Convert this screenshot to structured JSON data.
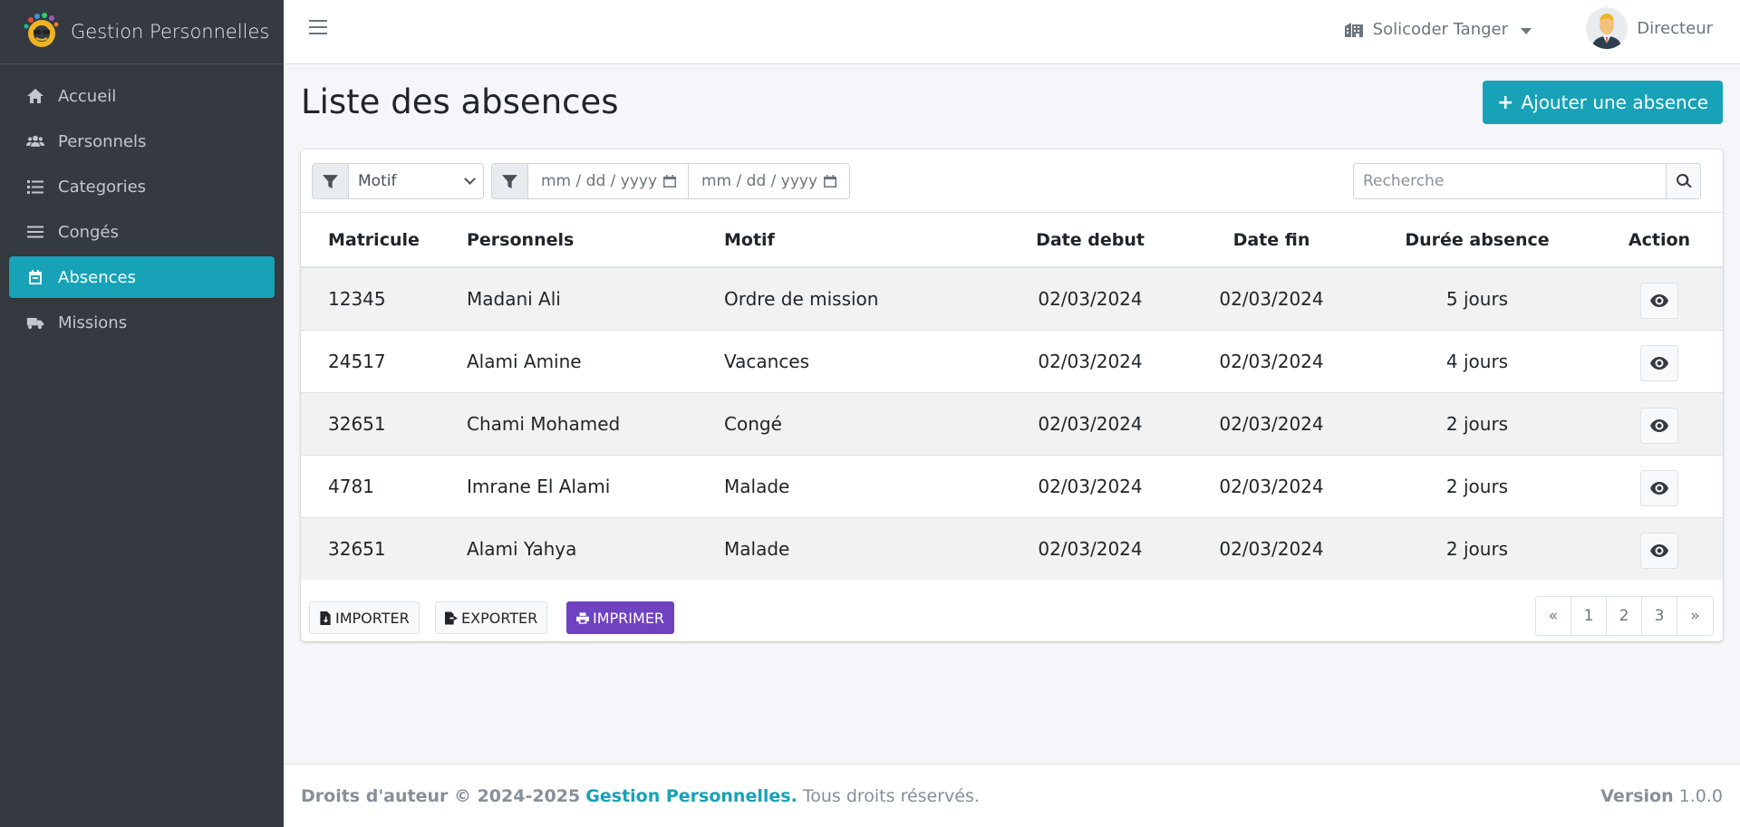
{
  "brand": {
    "name": "Gestion Personnelles"
  },
  "sidebar": {
    "items": [
      {
        "label": "Accueil",
        "icon": "home-icon"
      },
      {
        "label": "Personnels",
        "icon": "users-icon"
      },
      {
        "label": "Categories",
        "icon": "list-icon"
      },
      {
        "label": "Congés",
        "icon": "bars-icon"
      },
      {
        "label": "Absences",
        "icon": "calendar-icon",
        "active": true
      },
      {
        "label": "Missions",
        "icon": "truck-icon"
      }
    ]
  },
  "header": {
    "company": "Solicoder Tanger",
    "user_role": "Directeur"
  },
  "page": {
    "title": "Liste des absences",
    "add_button": "Ajouter une absence"
  },
  "filters": {
    "motif_select": "Motif",
    "date_start_placeholder": "mm / dd / yyyy",
    "date_end_placeholder": "mm / dd / yyyy",
    "search_placeholder": "Recherche"
  },
  "table": {
    "headers": [
      "Matricule",
      "Personnels",
      "Motif",
      "Date debut",
      "Date fin",
      "Durée absence",
      "Action"
    ],
    "rows": [
      {
        "matricule": "12345",
        "personnel": "Madani Ali",
        "motif": "Ordre de mission",
        "debut": "02/03/2024",
        "fin": "02/03/2024",
        "duree": "5 jours"
      },
      {
        "matricule": "24517",
        "personnel": "Alami Amine",
        "motif": "Vacances",
        "debut": "02/03/2024",
        "fin": "02/03/2024",
        "duree": "4 jours"
      },
      {
        "matricule": "32651",
        "personnel": "Chami Mohamed",
        "motif": "Congé",
        "debut": "02/03/2024",
        "fin": "02/03/2024",
        "duree": "2 jours"
      },
      {
        "matricule": "4781",
        "personnel": "Imrane El Alami",
        "motif": "Malade",
        "debut": "02/03/2024",
        "fin": "02/03/2024",
        "duree": "2 jours"
      },
      {
        "matricule": "32651",
        "personnel": "Alami Yahya",
        "motif": "Malade",
        "debut": "02/03/2024",
        "fin": "02/03/2024",
        "duree": "2 jours"
      }
    ]
  },
  "actions": {
    "import": "IMPORTER",
    "export": "EXPORTER",
    "print": "IMPRIMER"
  },
  "pagination": {
    "prev": "«",
    "pages": [
      "1",
      "2",
      "3"
    ],
    "next": "»"
  },
  "footer": {
    "copyright": "Droits d'auteur © 2024-2025",
    "brand": "Gestion Personnelles.",
    "rights": "Tous droits réservés.",
    "version_label": "Version",
    "version": "1.0.0"
  },
  "colors": {
    "accent": "#17a2b8",
    "sidebar": "#343a40",
    "print": "#6f42c1"
  }
}
